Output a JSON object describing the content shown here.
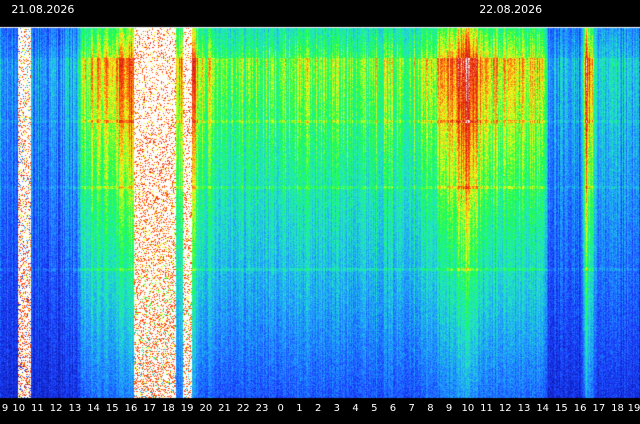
{
  "chart_data": {
    "type": "heatmap",
    "title": "",
    "xlabel": "",
    "ylabel": "",
    "dates": [
      {
        "text": "21.08.2026",
        "at_hour": 9.5
      },
      {
        "text": "22.08.2026",
        "at_hour": 34.5
      }
    ],
    "x_tick_labels": [
      "9",
      "10",
      "11",
      "12",
      "13",
      "14",
      "15",
      "16",
      "17",
      "18",
      "19",
      "20",
      "21",
      "22",
      "23",
      "0",
      "1",
      "2",
      "3",
      "4",
      "5",
      "6",
      "7",
      "8",
      "9",
      "10",
      "11",
      "12",
      "13",
      "14",
      "15",
      "16",
      "17",
      "18",
      "19"
    ],
    "x_range_hours": [
      9,
      43.2
    ],
    "grid": false,
    "legend": "none",
    "colormap": [
      "#0a14a0",
      "#1b3fff",
      "#1f9bff",
      "#22e6c4",
      "#1cff4a",
      "#f2ff1a",
      "#ff5a10",
      "#d01010",
      "#ffffff"
    ],
    "intensity_by_hour": [
      {
        "hour": 9,
        "v": 0.22
      },
      {
        "hour": 10,
        "v": 0.24
      },
      {
        "hour": 11,
        "v": 0.25
      },
      {
        "hour": 12,
        "v": 0.25
      },
      {
        "hour": 13,
        "v": 0.3
      },
      {
        "hour": 13.5,
        "v": 0.55
      },
      {
        "hour": 14,
        "v": 0.62
      },
      {
        "hour": 15,
        "v": 0.65
      },
      {
        "hour": 16,
        "v": 0.75
      },
      {
        "hour": 16.5,
        "v": 0.98
      },
      {
        "hour": 17,
        "v": 1.0
      },
      {
        "hour": 18,
        "v": 1.0
      },
      {
        "hour": 18.6,
        "v": 0.6
      },
      {
        "hour": 19,
        "v": 0.95
      },
      {
        "hour": 19.6,
        "v": 0.62
      },
      {
        "hour": 20,
        "v": 0.58
      },
      {
        "hour": 21,
        "v": 0.52
      },
      {
        "hour": 22,
        "v": 0.5
      },
      {
        "hour": 23,
        "v": 0.5
      },
      {
        "hour": 0,
        "v": 0.52
      },
      {
        "hour": 1,
        "v": 0.55
      },
      {
        "hour": 2,
        "v": 0.52
      },
      {
        "hour": 3,
        "v": 0.52
      },
      {
        "hour": 4,
        "v": 0.52
      },
      {
        "hour": 5,
        "v": 0.53
      },
      {
        "hour": 6,
        "v": 0.53
      },
      {
        "hour": 7,
        "v": 0.53
      },
      {
        "hour": 8,
        "v": 0.58
      },
      {
        "hour": 9,
        "v": 0.68
      },
      {
        "hour": 10,
        "v": 0.9
      },
      {
        "hour": 10.5,
        "v": 0.7
      },
      {
        "hour": 11,
        "v": 0.6
      },
      {
        "hour": 12,
        "v": 0.62
      },
      {
        "hour": 13,
        "v": 0.62
      },
      {
        "hour": 14,
        "v": 0.6
      },
      {
        "hour": 14.3,
        "v": 0.3
      },
      {
        "hour": 15,
        "v": 0.24
      },
      {
        "hour": 16,
        "v": 0.26
      },
      {
        "hour": 16.3,
        "v": 0.85
      },
      {
        "hour": 17,
        "v": 0.28
      },
      {
        "hour": 18,
        "v": 0.3
      },
      {
        "hour": 19,
        "v": 0.28
      }
    ],
    "bright_bands_hours": [
      {
        "start": 16.4,
        "end": 18.3
      },
      {
        "start": 18.8,
        "end": 19.2
      },
      {
        "start": 10.0,
        "end": 10.6
      },
      {
        "start": 16.2,
        "end": 16.4
      }
    ],
    "horizontal_lines_rel": [
      0.25,
      0.43,
      0.65
    ]
  }
}
